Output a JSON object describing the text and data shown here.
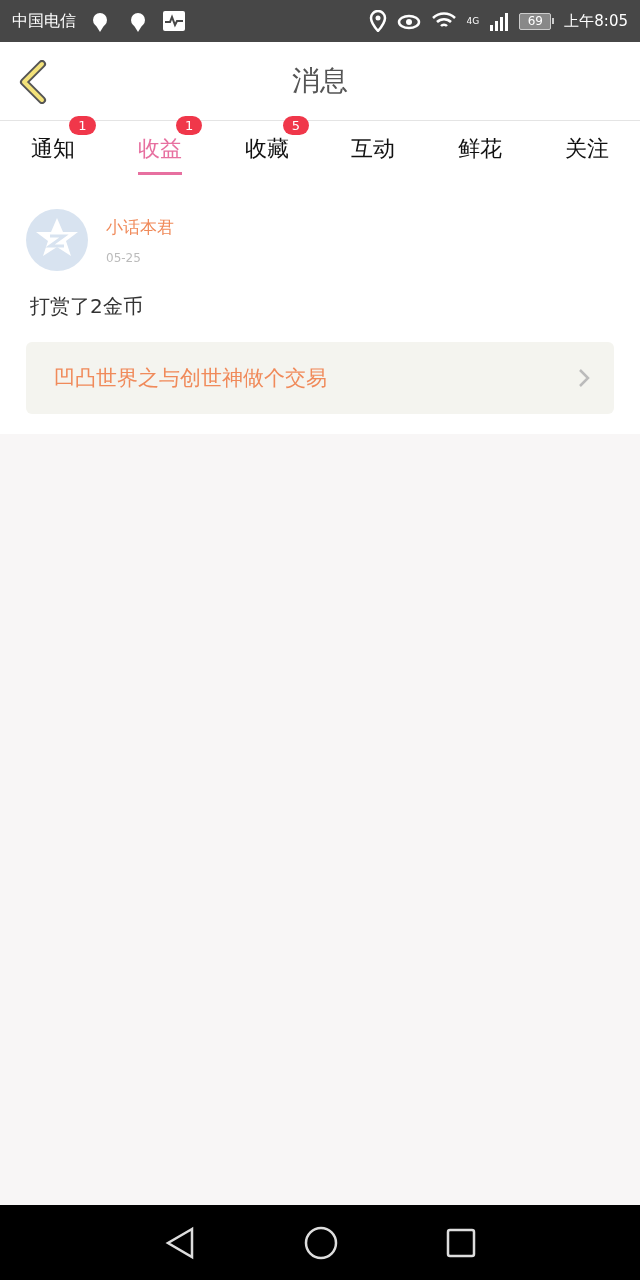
{
  "status_bar": {
    "carrier": "中国电信",
    "network": "4G",
    "battery": "69",
    "time": "上午8:05"
  },
  "header": {
    "title": "消息"
  },
  "tabs": [
    {
      "label": "通知",
      "selected": false,
      "badge": "1"
    },
    {
      "label": "收益",
      "selected": true,
      "badge": "1"
    },
    {
      "label": "收藏",
      "selected": false,
      "badge": "5"
    },
    {
      "label": "互动",
      "selected": false
    },
    {
      "label": "鲜花",
      "selected": false
    },
    {
      "label": "关注",
      "selected": false
    }
  ],
  "messages": [
    {
      "user": "小话本君",
      "date": "05-25",
      "text": "打赏了2金币",
      "link": "凹凸世界之与创世神做个交易"
    }
  ]
}
